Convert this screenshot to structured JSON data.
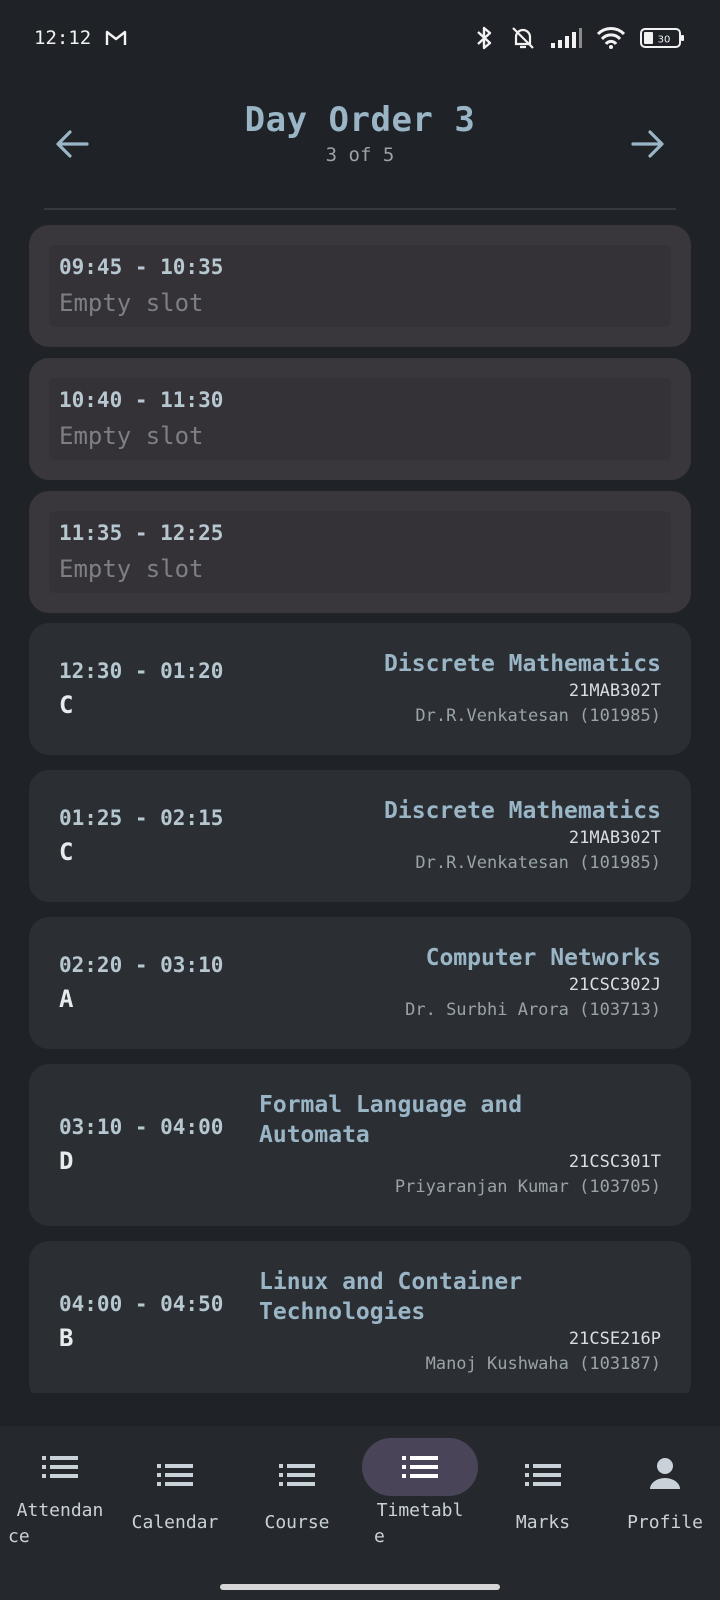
{
  "status_bar": {
    "time": "12:12",
    "battery": "30"
  },
  "header": {
    "title": "Day Order 3",
    "subtitle": "3 of 5"
  },
  "slots": [
    {
      "time": "09:45 - 10:35",
      "empty_label": "Empty slot"
    },
    {
      "time": "10:40 - 11:30",
      "empty_label": "Empty slot"
    },
    {
      "time": "11:35 - 12:25",
      "empty_label": "Empty slot"
    },
    {
      "time": "12:30 - 01:20",
      "slot": "C",
      "course": "Discrete Mathematics",
      "code": "21MAB302T",
      "faculty": "Dr.R.Venkatesan (101985)"
    },
    {
      "time": "01:25 - 02:15",
      "slot": "C",
      "course": "Discrete Mathematics",
      "code": "21MAB302T",
      "faculty": "Dr.R.Venkatesan (101985)"
    },
    {
      "time": "02:20 - 03:10",
      "slot": "A",
      "course": "Computer Networks",
      "code": "21CSC302J",
      "faculty": "Dr. Surbhi Arora (103713)"
    },
    {
      "time": "03:10 - 04:00",
      "slot": "D",
      "course_line1": "Formal Language and",
      "course_line2": "Automata",
      "code": "21CSC301T",
      "faculty": "Priyaranjan Kumar (103705)"
    },
    {
      "time": "04:00 - 04:50",
      "slot": "B",
      "course_line1": "Linux and Container",
      "course_line2": "Technologies",
      "code": "21CSE216P",
      "faculty": "Manoj Kushwaha (103187)"
    }
  ],
  "bottom_nav": {
    "attendance_line1": "Attendan",
    "attendance_line2": "ce",
    "calendar": "Calendar",
    "course": "Course",
    "timetable_line1": "Timetabl",
    "timetable_line2": "e",
    "marks": "Marks",
    "profile": "Profile",
    "active": "Timetable"
  }
}
